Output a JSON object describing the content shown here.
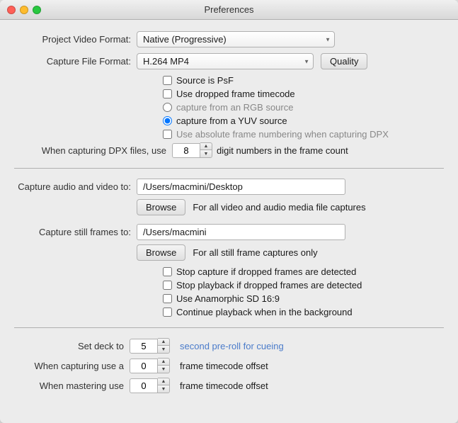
{
  "window": {
    "title": "Preferences"
  },
  "titlebar": {
    "title": "Preferences"
  },
  "form": {
    "project_video_format_label": "Project Video Format:",
    "project_video_format_value": "Native (Progressive)",
    "capture_file_format_label": "Capture File Format:",
    "capture_file_format_value": "H.264 MP4",
    "quality_button": "Quality",
    "source_is_psf_label": "Source is PsF",
    "use_dropped_frame_timecode_label": "Use dropped frame timecode",
    "capture_from_rgb_label": "capture from an RGB source",
    "capture_from_yuv_label": "capture from a YUV source",
    "use_absolute_frame_label": "Use absolute frame numbering when capturing DPX",
    "when_capturing_dpx_label": "When capturing DPX files, use",
    "digit_number_label": "digit numbers in the frame count",
    "dpx_digit_value": "8",
    "capture_audio_video_label": "Capture audio and video to:",
    "capture_audio_video_path": "/Users/macmini/Desktop",
    "browse_label": "Browse",
    "for_all_video_label": "For all video and audio media file captures",
    "capture_still_frames_label": "Capture still frames to:",
    "capture_still_frames_path": "/Users/macmini",
    "browse2_label": "Browse",
    "for_all_still_label": "For all still frame captures only",
    "stop_capture_dropped_label": "Stop capture if dropped frames are detected",
    "stop_playback_dropped_label": "Stop playback if dropped frames are detected",
    "use_anamorphic_label": "Use Anamorphic SD 16:9",
    "continue_playback_label": "Continue playback when in the background",
    "set_deck_label": "Set deck to",
    "set_deck_value": "5",
    "set_deck_suffix": "second pre-roll for cueing",
    "when_capturing_label": "When capturing use a",
    "when_capturing_value": "0",
    "when_capturing_suffix": "frame timecode offset",
    "when_mastering_label": "When mastering use",
    "when_mastering_value": "0",
    "when_mastering_suffix": "frame timecode offset"
  }
}
